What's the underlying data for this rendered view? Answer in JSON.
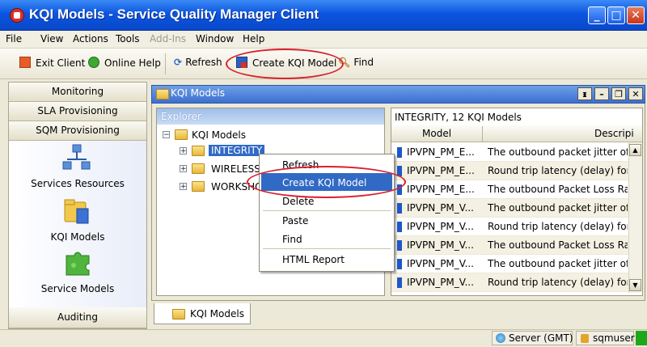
{
  "window": {
    "title": "KQI Models - Service Quality Manager Client"
  },
  "menu": [
    "File",
    "View",
    "Actions",
    "Tools",
    "Add-Ins",
    "Window",
    "Help"
  ],
  "toolbar": {
    "exit_label": "Exit Client",
    "help_label": "Online Help",
    "refresh_label": "Refresh",
    "create_label": "Create KQI Model",
    "find_label": "Find"
  },
  "nav": {
    "tabs": [
      "Monitoring",
      "SLA Provisioning",
      "SQM Provisioning"
    ],
    "items": [
      "Services Resources",
      "KQI Models",
      "Service Models"
    ],
    "bottom_tab": "Auditing"
  },
  "panel": {
    "title": "KQI Models"
  },
  "explorer": {
    "header": "Explorer",
    "root": "KQI Models",
    "nodes": [
      "INTEGRITY",
      "WIRELESS",
      "WORKSHO"
    ]
  },
  "grid": {
    "caption": "INTEGRITY, 12 KQI Models",
    "columns": [
      "Model",
      "Descripi"
    ],
    "rows": [
      {
        "model": "IPVPN_PM_E...",
        "desc": "The outbound packet jitter of VF"
      },
      {
        "model": "IPVPN_PM_E...",
        "desc": "Round trip latency (delay) for  a"
      },
      {
        "model": "IPVPN_PM_E...",
        "desc": "The outbound Packet Loss Ratio"
      },
      {
        "model": "IPVPN_PM_V...",
        "desc": "The outbound packet jitter of VF"
      },
      {
        "model": "IPVPN_PM_V...",
        "desc": "Round trip latency (delay) for a"
      },
      {
        "model": "IPVPN_PM_V...",
        "desc": "The outbound Packet Loss Ratio"
      },
      {
        "model": "IPVPN_PM_V...",
        "desc": "The outbound packet jitter of VF"
      },
      {
        "model": "IPVPN_PM_V...",
        "desc": "Round trip latency (delay) for a"
      }
    ]
  },
  "context_menu": [
    "Refresh",
    "Create KQI Model",
    "Delete",
    "Paste",
    "Find",
    "HTML Report"
  ],
  "bottom_tab": "KQI Models",
  "status": {
    "server": "Server (GMT)",
    "user": "sqmuser"
  },
  "colors": {
    "titlebar": "#0b55e0",
    "selection": "#316ac5",
    "annotation": "#d8202a"
  }
}
